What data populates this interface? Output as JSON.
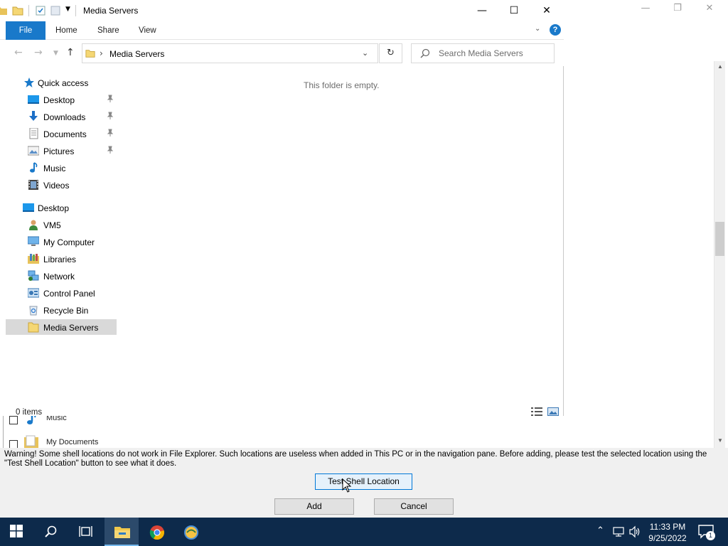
{
  "explorer": {
    "title": "Media Servers",
    "window_controls": {
      "minimize": "—",
      "maximize": "☐",
      "close": "✕"
    },
    "ribbon_tabs": [
      "File",
      "Home",
      "Share",
      "View"
    ],
    "help_label": "?",
    "address_crumb": "Media Servers",
    "search_placeholder": "Search Media Servers",
    "empty_message": "This folder is empty.",
    "status_text": "0 items",
    "nav_pane": {
      "quick_access": "Quick access",
      "quick_items": [
        "Desktop",
        "Downloads",
        "Documents",
        "Pictures",
        "Music",
        "Videos"
      ],
      "desktop_root": "Desktop",
      "desktop_items": [
        "VM5",
        "My Computer",
        "Libraries",
        "Network",
        "Control Panel",
        "Recycle Bin",
        "Media Servers"
      ],
      "selected": "Media Servers"
    }
  },
  "dialog": {
    "list_items": [
      "Music",
      "My Documents"
    ],
    "warning": "Warning! Some shell locations do not work in File Explorer. Such locations are useless when added in This PC or in the navigation pane. Before adding, please test the selected location using the \"Test Shell Location\" button to see what it does.",
    "test_button": "Test Shell Location",
    "add_button": "Add",
    "cancel_button": "Cancel"
  },
  "taskbar": {
    "time": "11:33 PM",
    "date": "9/25/2022",
    "notification_count": "1",
    "apps": [
      "start-icon",
      "search-icon",
      "task-view-icon",
      "file-explorer-icon",
      "chrome-icon",
      "app-icon"
    ]
  },
  "colors": {
    "accent": "#1979ca",
    "taskbar": "#0d2a4b",
    "selection": "#d9d9d9",
    "button_focus_border": "#0078d7"
  }
}
